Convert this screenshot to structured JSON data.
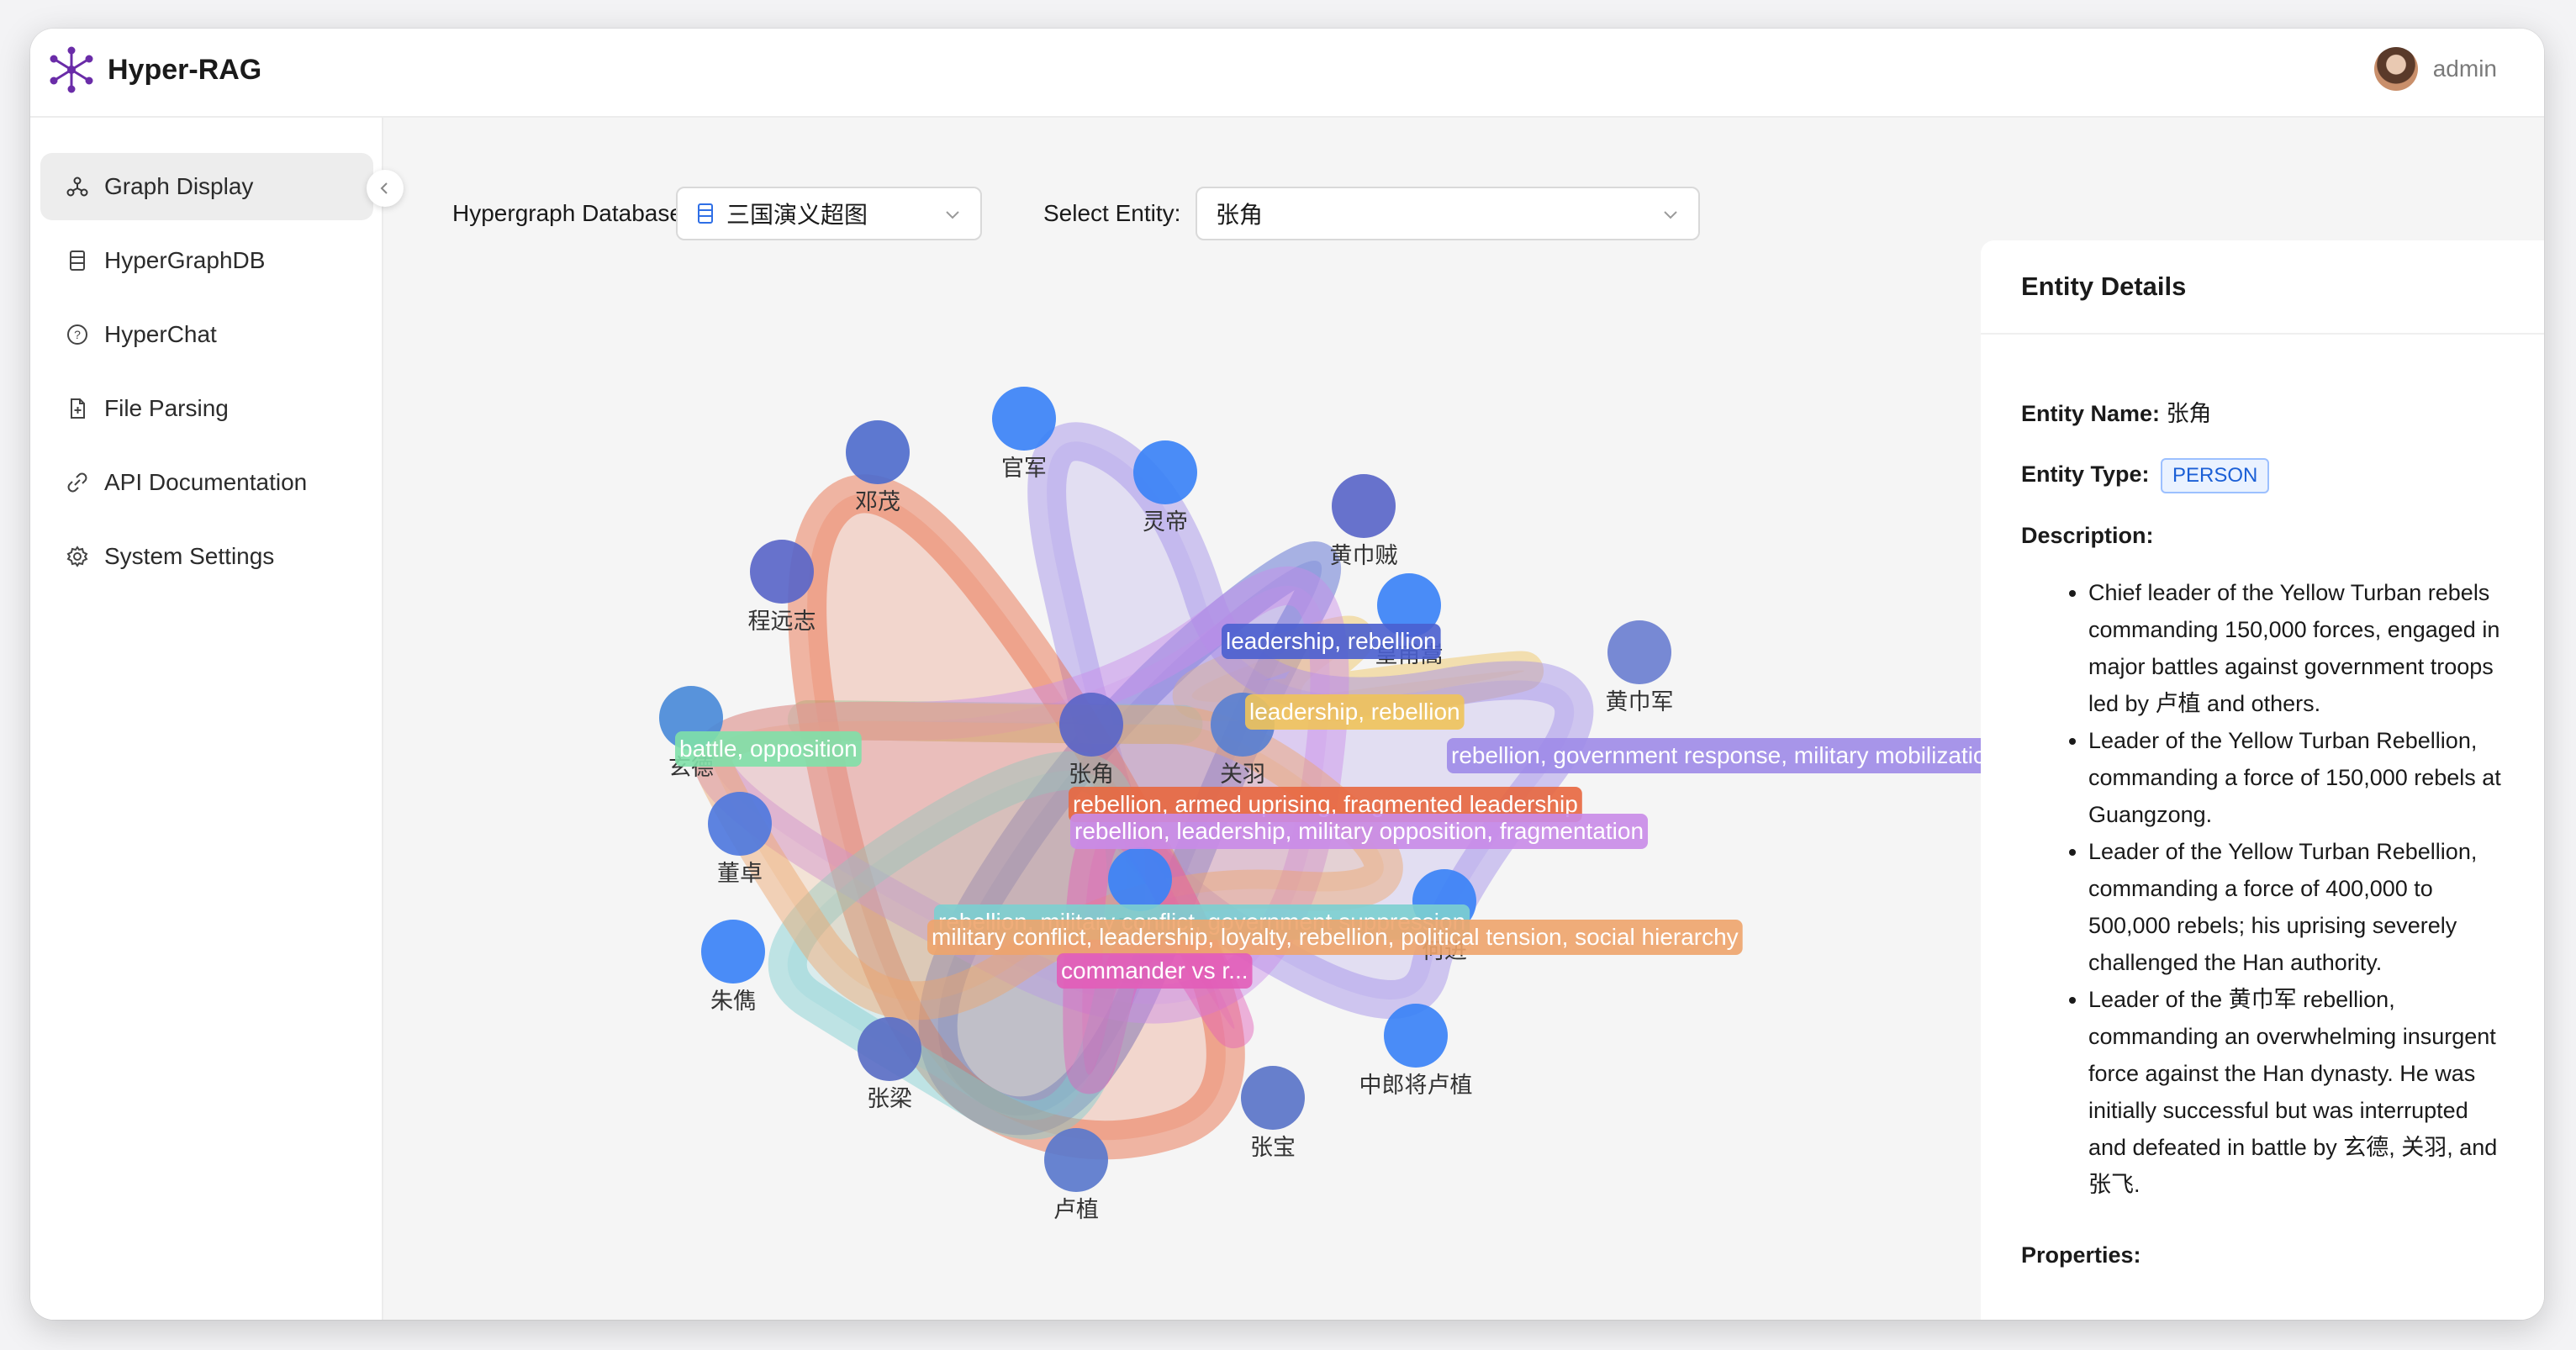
{
  "app": {
    "title": "Hyper-RAG"
  },
  "user": {
    "name": "admin"
  },
  "sidebar": {
    "items": [
      {
        "label": "Graph Display",
        "icon": "graph-nodes-icon",
        "active": true
      },
      {
        "label": "HyperGraphDB",
        "icon": "database-icon"
      },
      {
        "label": "HyperChat",
        "icon": "question-circle-icon"
      },
      {
        "label": "File Parsing",
        "icon": "file-icon"
      },
      {
        "label": "API Documentation",
        "icon": "api-link-icon"
      },
      {
        "label": "System Settings",
        "icon": "gear-icon"
      }
    ]
  },
  "filters": {
    "database_label": "Hypergraph Database:",
    "database_value": "三国演义超图",
    "entity_label": "Select Entity:",
    "entity_value": "张角"
  },
  "graph": {
    "nodes": [
      {
        "label": "官军",
        "color": "#3b82f6"
      },
      {
        "label": "灵帝",
        "color": "#3b82f6"
      },
      {
        "label": "邓茂",
        "color": "#4f6ccc"
      },
      {
        "label": "黄巾贼",
        "color": "#5a66c8"
      },
      {
        "label": "程远志",
        "color": "#5a66c8"
      },
      {
        "label": "皇甫嵩",
        "color": "#3b82f6"
      },
      {
        "label": "黄巾军",
        "color": "#6b7fd0"
      },
      {
        "label": "玄德",
        "color": "#4a8ad8"
      },
      {
        "label": "张角",
        "color": "#5a66c8"
      },
      {
        "label": "关羽",
        "color": "#5a80d0"
      },
      {
        "label": "董卓",
        "color": "#4f78dd"
      },
      {
        "label": "张飞",
        "color": "#3b82f6"
      },
      {
        "label": "何进",
        "color": "#3b82f6"
      },
      {
        "label": "朱儁",
        "color": "#3b82f6"
      },
      {
        "label": "中郎将卢植",
        "color": "#3b82f6"
      },
      {
        "label": "张梁",
        "color": "#5a6ec4"
      },
      {
        "label": "张宝",
        "color": "#5a74c8"
      },
      {
        "label": "卢植",
        "color": "#5a78cc"
      }
    ],
    "edges": [
      {
        "label": "leadership, rebellion",
        "color": "#4a5fcf"
      },
      {
        "label": "leadership, rebellion",
        "color": "#f0c35a"
      },
      {
        "label": "battle, opposition",
        "color": "#7fe0a8"
      },
      {
        "label": "rebellion, government response, military mobilization, conflict",
        "color": "#9f8be8"
      },
      {
        "label": "rebellion, armed uprising, fragmented leadership",
        "color": "#e8673f"
      },
      {
        "label": "rebellion, leadership, military opposition, fragmentation",
        "color": "#c98be8"
      },
      {
        "label": "rebellion, military conflict, government suppression",
        "color": "#7ccfd0"
      },
      {
        "label": "military conflict, leadership, loyalty, rebellion, political tension, social hierarchy",
        "color": "#eea46b"
      },
      {
        "label": "commander vs r...",
        "color": "#e25db8"
      }
    ]
  },
  "details": {
    "title": "Entity Details",
    "name_key": "Entity Name:",
    "name_value": "张角",
    "type_key": "Entity Type:",
    "type_value": "PERSON",
    "description_key": "Description:",
    "descriptions": [
      "Chief leader of the Yellow Turban rebels commanding 150,000 forces, engaged in major battles against government troops led by 卢植 and others.",
      "Leader of the Yellow Turban Rebellion, commanding a force of 150,000 rebels at Guangzong.",
      "Leader of the Yellow Turban Rebellion, commanding a force of 400,000 to 500,000 rebels; his uprising severely challenged the Han authority.",
      "Leader of the 黄巾军 rebellion, commanding an overwhelming insurgent force against the Han dynasty. He was initially successful but was interrupted and defeated in battle by 玄德, 关羽, and 张飞."
    ],
    "properties_key": "Properties:"
  }
}
